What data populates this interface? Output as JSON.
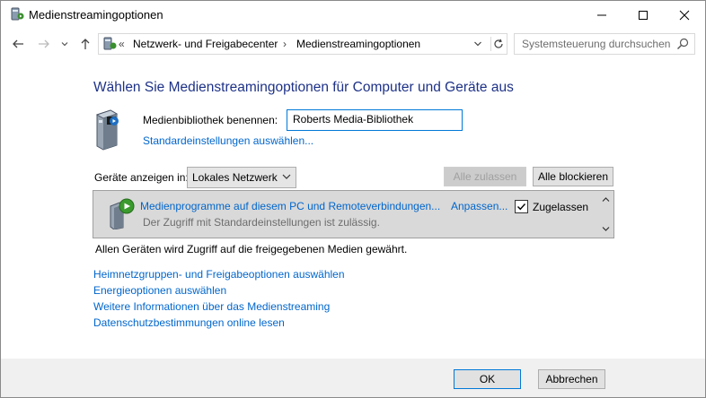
{
  "window": {
    "title": "Medienstreamingoptionen"
  },
  "address": {
    "overflow": "«",
    "crumbs": [
      "Netzwerk- und Freigabecenter",
      "Medienstreamingoptionen"
    ],
    "separator": "›",
    "search_placeholder": "Systemsteuerung durchsuchen"
  },
  "main": {
    "heading": "Wählen Sie Medienstreamingoptionen für Computer und Geräte aus",
    "library_label": "Medienbibliothek benennen:",
    "library_name": "Roberts Media-Bibliothek",
    "defaults_link": "Standardeinstellungen auswählen...",
    "devices_label": "Geräte anzeigen in:",
    "devices_select": "Lokales Netzwerk",
    "allow_all": "Alle zulassen",
    "block_all": "Alle blockieren",
    "device": {
      "name": "Medienprogramme auf diesem PC und Remoteverbindungen...",
      "status": "Der Zugriff mit Standardeinstellungen ist zulässig.",
      "customize": "Anpassen...",
      "allowed_label": "Zugelassen",
      "allowed": true
    },
    "all_devices_note": "Allen Geräten wird Zugriff auf die freigegebenen Medien gewährt.",
    "links": [
      "Heimnetzgruppen- und Freigabeoptionen auswählen",
      "Energieoptionen auswählen",
      "Weitere Informationen über das Medienstreaming",
      "Datenschutzbestimmungen online lesen"
    ]
  },
  "footer": {
    "ok": "OK",
    "cancel": "Abbrechen"
  },
  "colors": {
    "link": "#0066cc",
    "heading": "#1e3287",
    "accent": "#0078d7"
  },
  "icons": [
    "media-server-icon",
    "back-arrow-icon",
    "forward-arrow-icon",
    "chevron-down-icon",
    "up-arrow-icon",
    "refresh-icon",
    "search-icon",
    "minimize-icon",
    "maximize-icon",
    "close-icon",
    "checkmark-icon",
    "scroll-up-icon",
    "scroll-down-icon",
    "media-device-icon"
  ]
}
